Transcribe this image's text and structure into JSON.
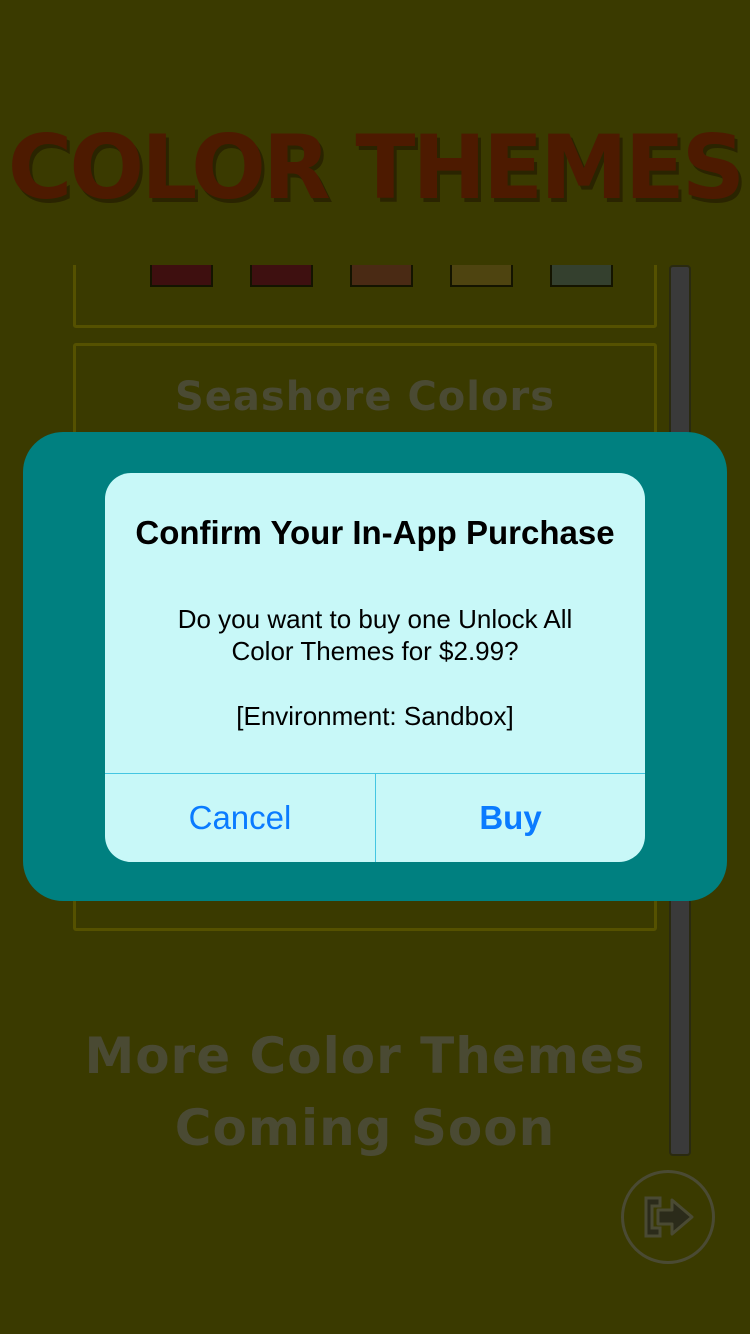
{
  "page": {
    "title": "COLOR THEMES"
  },
  "themes": [
    {
      "name": "",
      "swatches": [
        "#3e0f0f",
        "#3e1010",
        "#4a2a14",
        "#4e4410",
        "#34402e"
      ]
    },
    {
      "name": "Seashore Colors",
      "swatches": []
    }
  ],
  "footer": {
    "coming_soon": "More Color Themes\nComing Soon",
    "exit_icon": "exit-arrow-icon"
  },
  "alert": {
    "title": "Confirm Your In-App Purchase",
    "message": "Do you want to buy one Unlock All\nColor Themes for $2.99?",
    "environment": "[Environment: Sandbox]",
    "cancel_label": "Cancel",
    "buy_label": "Buy"
  },
  "colors": {
    "background_dimmed": "#3a3a00",
    "overlay_panel": "#008080",
    "alert_bg": "#c8f8f8",
    "ios_blue": "#0a7bff"
  }
}
